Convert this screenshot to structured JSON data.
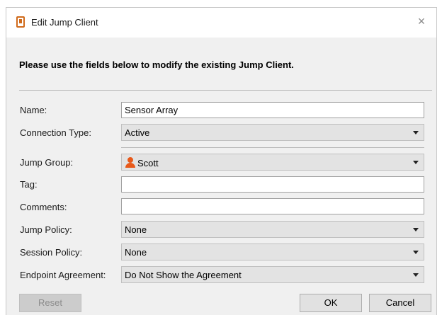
{
  "window": {
    "title": "Edit Jump Client",
    "close_glyph": "×"
  },
  "instructions": "Please use the fields below to modify the existing Jump Client.",
  "form": {
    "name": {
      "label": "Name:",
      "value": "Sensor Array"
    },
    "connection_type": {
      "label": "Connection Type:",
      "value": "Active"
    },
    "jump_group": {
      "label": "Jump Group:",
      "value": "Scott",
      "icon": "person-icon"
    },
    "tag": {
      "label": "Tag:",
      "value": ""
    },
    "comments": {
      "label": "Comments:",
      "value": ""
    },
    "jump_policy": {
      "label": "Jump Policy:",
      "value": "None"
    },
    "session_policy": {
      "label": "Session Policy:",
      "value": "None"
    },
    "endpoint_agreement": {
      "label": "Endpoint Agreement:",
      "value": "Do Not Show the Agreement"
    }
  },
  "buttons": {
    "reset": "Reset",
    "ok": "OK",
    "cancel": "Cancel"
  },
  "colors": {
    "accent": "#d06b1c",
    "person_icon": "#e8591a"
  }
}
